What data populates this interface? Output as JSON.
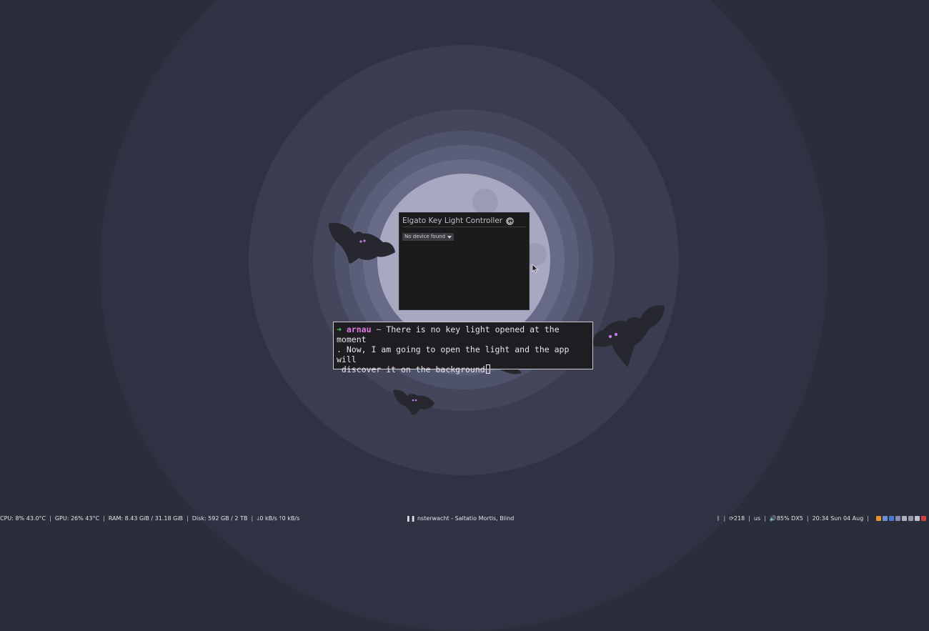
{
  "app_window": {
    "title": "Elgato Key Light Controller",
    "device_select": {
      "selected": "No device found"
    }
  },
  "terminal": {
    "user": "arnau",
    "path": "~",
    "message_line1": "There is no key light opened at the moment",
    "message_line2": ". Now, I am going to open the light and the app will",
    "message_line3": " discover it on the background"
  },
  "statusbar": {
    "cpu": "CPU: 8% 43.0°C",
    "gpu": "GPU: 26% 43°C",
    "ram": "RAM: 8.43 GiB / 31.18 GiB",
    "disk": "Disk: 592 GB / 2 TB",
    "net_down": "0 kB/s",
    "net_up": "0 kB/s",
    "now_playing": "nsterwacht - Saltatio Mortis, Blind",
    "updates": "218",
    "keyboard_layout": "us",
    "volume": "85% DX5",
    "datetime": "20:34 Sun 04 Aug"
  }
}
